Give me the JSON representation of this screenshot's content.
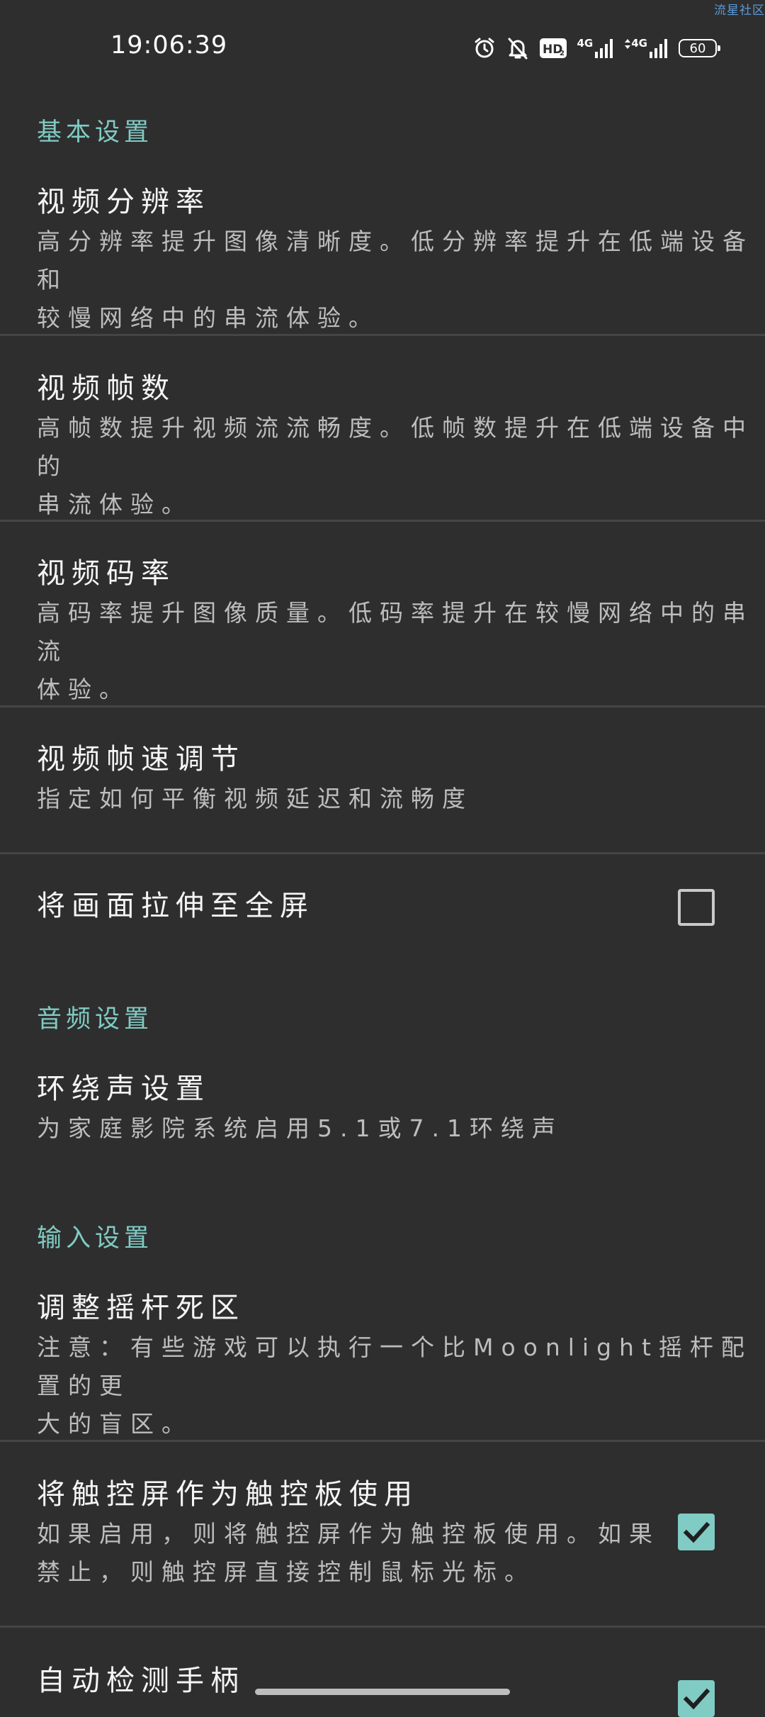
{
  "watermark": "流星社区",
  "status_bar": {
    "time": "19:06:39",
    "icons": [
      "alarm-icon",
      "mute-bell-icon",
      "hd-icon",
      "signal-4g-icon",
      "signal-4g-icon-2",
      "battery-icon"
    ],
    "hd_label": "HD",
    "signal1_label": "4G",
    "signal2_label": "4G",
    "battery_level": "60"
  },
  "sections": {
    "basic": {
      "header": "基本设置",
      "resolution": {
        "title": "视频分辨率",
        "summary_line1": "高分辨率提升图像清晰度。低分辨率提升在低端设备和",
        "summary_line2": "较慢网络中的串流体验。"
      },
      "fps": {
        "title": "视频帧数",
        "summary_line1": "高帧数提升视频流流畅度。低帧数提升在低端设备中的",
        "summary_line2": "串流体验。"
      },
      "bitrate": {
        "title": "视频码率",
        "summary_line1": "高码率提升图像质量。低码率提升在较慢网络中的串流",
        "summary_line2": "体验。"
      },
      "pacing": {
        "title": "视频帧速调节",
        "summary_line1": "指定如何平衡视频延迟和流畅度"
      },
      "stretch": {
        "title": "将画面拉伸至全屏",
        "checked": false
      }
    },
    "audio": {
      "header": "音频设置",
      "surround": {
        "title": "环绕声设置",
        "summary_line1": "为家庭影院系统启用5.1或7.1环绕声"
      }
    },
    "input": {
      "header": "输入设置",
      "deadzone": {
        "title": "调整摇杆死区",
        "summary_line1": "注意：有些游戏可以执行一个比Moonlight摇杆配置的更",
        "summary_line2": "大的盲区。"
      },
      "touchpad": {
        "title": "将触控屏作为触控板使用",
        "summary_line1": "如果启用，则将触控屏作为触控板使用。如果",
        "summary_line2": "禁止，则触控屏直接控制鼠标光标。",
        "checked": true
      },
      "autodetect": {
        "title": "自动检测手柄",
        "checked": true
      }
    }
  },
  "colors": {
    "background": "#2e2e2e",
    "accent": "#80cbc4",
    "divider": "#454545",
    "summary_text": "#bdbdbd"
  }
}
